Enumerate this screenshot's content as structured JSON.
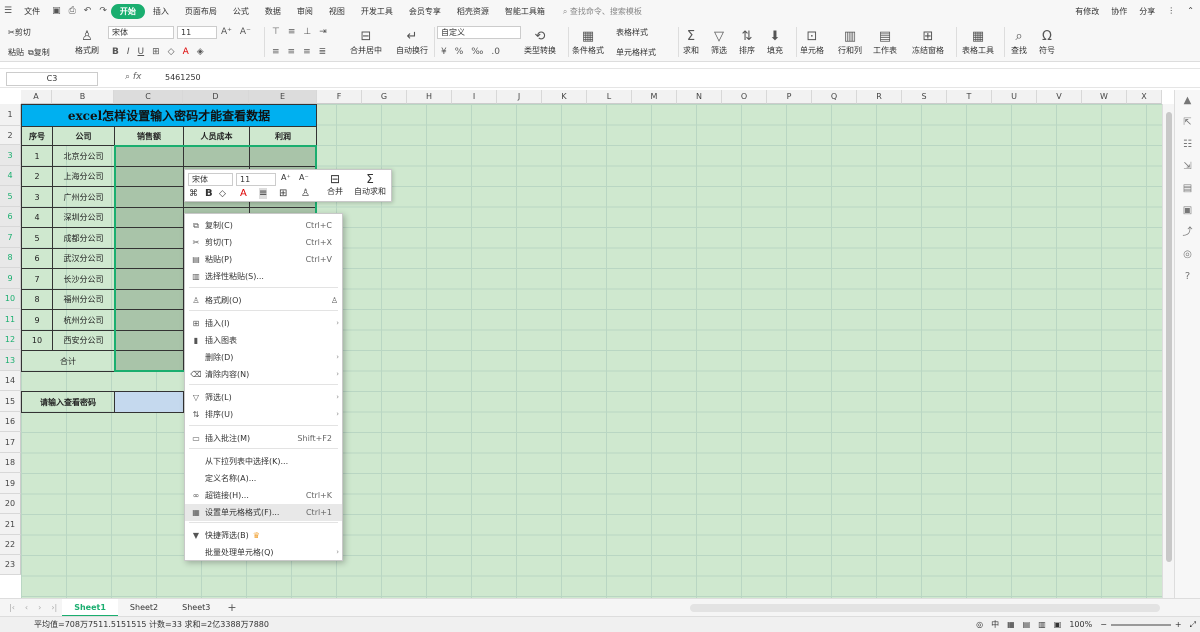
{
  "menubar": {
    "file": "文件",
    "tabs": [
      "开始",
      "插入",
      "页面布局",
      "公式",
      "数据",
      "审阅",
      "视图",
      "开发工具",
      "会员专享",
      "稻壳资源",
      "智能工具箱"
    ],
    "search": "查找命令、搜索模板",
    "right": [
      "有修改",
      "协作",
      "分享"
    ]
  },
  "ribbon": {
    "cut": "剪切",
    "copy": "复制",
    "paste": "粘贴",
    "format_painter": "格式刷",
    "font_name": "宋体",
    "font_size": "11",
    "merge": "合并居中",
    "wrap": "自动换行",
    "number_format": "自定义",
    "type_convert": "类型转换",
    "cond_format": "条件格式",
    "table_style": "表格样式",
    "cell_style": "单元格样式",
    "sum": "求和",
    "filter": "筛选",
    "sort": "排序",
    "fill": "填充",
    "cell": "单元格",
    "rowcol": "行和列",
    "worksheet": "工作表",
    "freeze": "冻结窗格",
    "table_tools": "表格工具",
    "find": "查找",
    "symbol": "符号"
  },
  "formula": {
    "cell_ref": "C3",
    "fx": "fx",
    "value": "5461250"
  },
  "columns": [
    "A",
    "B",
    "C",
    "D",
    "E",
    "F",
    "G",
    "H",
    "I",
    "J",
    "K",
    "L",
    "M",
    "N",
    "O",
    "P",
    "Q",
    "R",
    "S",
    "T",
    "U",
    "V",
    "W",
    "X"
  ],
  "rows": [
    "1",
    "2",
    "3",
    "4",
    "5",
    "6",
    "7",
    "8",
    "9",
    "10",
    "11",
    "12",
    "13",
    "14",
    "15",
    "16",
    "17",
    "18",
    "19",
    "20",
    "21",
    "22",
    "23"
  ],
  "sheet": {
    "title": "excel怎样设置输入密码才能查看数据",
    "headers": [
      "序号",
      "公司",
      "销售额",
      "人员成本",
      "利润"
    ],
    "data": [
      [
        "1",
        "北京分公司"
      ],
      [
        "2",
        "上海分公司"
      ],
      [
        "3",
        "广州分公司"
      ],
      [
        "4",
        "深圳分公司"
      ],
      [
        "5",
        "成都分公司"
      ],
      [
        "6",
        "武汉分公司"
      ],
      [
        "7",
        "长沙分公司"
      ],
      [
        "8",
        "福州分公司"
      ],
      [
        "9",
        "杭州分公司"
      ],
      [
        "10",
        "西安分公司"
      ]
    ],
    "total_label": "合计",
    "password_label": "请输入查看密码"
  },
  "mini_toolbar": {
    "font": "宋体",
    "size": "11",
    "merge": "合并",
    "autosum": "自动求和"
  },
  "context_menu": [
    {
      "icon": "copy-icon",
      "label": "复制(C)",
      "shortcut": "Ctrl+C"
    },
    {
      "icon": "cut-icon",
      "label": "剪切(T)",
      "shortcut": "Ctrl+X"
    },
    {
      "icon": "paste-icon",
      "label": "粘贴(P)",
      "shortcut": "Ctrl+V"
    },
    {
      "icon": "paste-special-icon",
      "label": "选择性粘贴(S)..."
    },
    {
      "icon": "format-painter-icon",
      "label": "格式刷(O)"
    },
    {
      "icon": "insert-icon",
      "label": "插入(I)",
      "arrow": true
    },
    {
      "icon": "chart-icon",
      "label": "插入图表"
    },
    {
      "label": "删除(D)",
      "arrow": true
    },
    {
      "icon": "eraser-icon",
      "label": "清除内容(N)",
      "arrow": true
    },
    {
      "icon": "filter-icon",
      "label": "筛选(L)",
      "arrow": true
    },
    {
      "icon": "sort-icon",
      "label": "排序(U)",
      "arrow": true
    },
    {
      "icon": "comment-icon",
      "label": "插入批注(M)",
      "shortcut": "Shift+F2"
    },
    {
      "label": "从下拉列表中选择(K)..."
    },
    {
      "label": "定义名称(A)..."
    },
    {
      "icon": "link-icon",
      "label": "超链接(H)...",
      "shortcut": "Ctrl+K"
    },
    {
      "icon": "format-cells-icon",
      "label": "设置单元格格式(F)...",
      "shortcut": "Ctrl+1",
      "highlight": true
    },
    {
      "icon": "quick-filter-icon",
      "label": "快捷筛选(B)",
      "crown": true
    },
    {
      "label": "批量处理单元格(Q)",
      "arrow": true
    }
  ],
  "tabs": [
    "Sheet1",
    "Sheet2",
    "Sheet3"
  ],
  "status": {
    "text": "平均值=708万7511.5151515  计数=33  求和=2亿3388万7880",
    "zoom": "100%"
  },
  "colors": {
    "accent": "#1aae6f",
    "sheet_bg": "#cfe8cf",
    "title_bg": "#00b0f0",
    "selected_cells": "#a9c4a9",
    "password_input": "#c5d9ee"
  }
}
